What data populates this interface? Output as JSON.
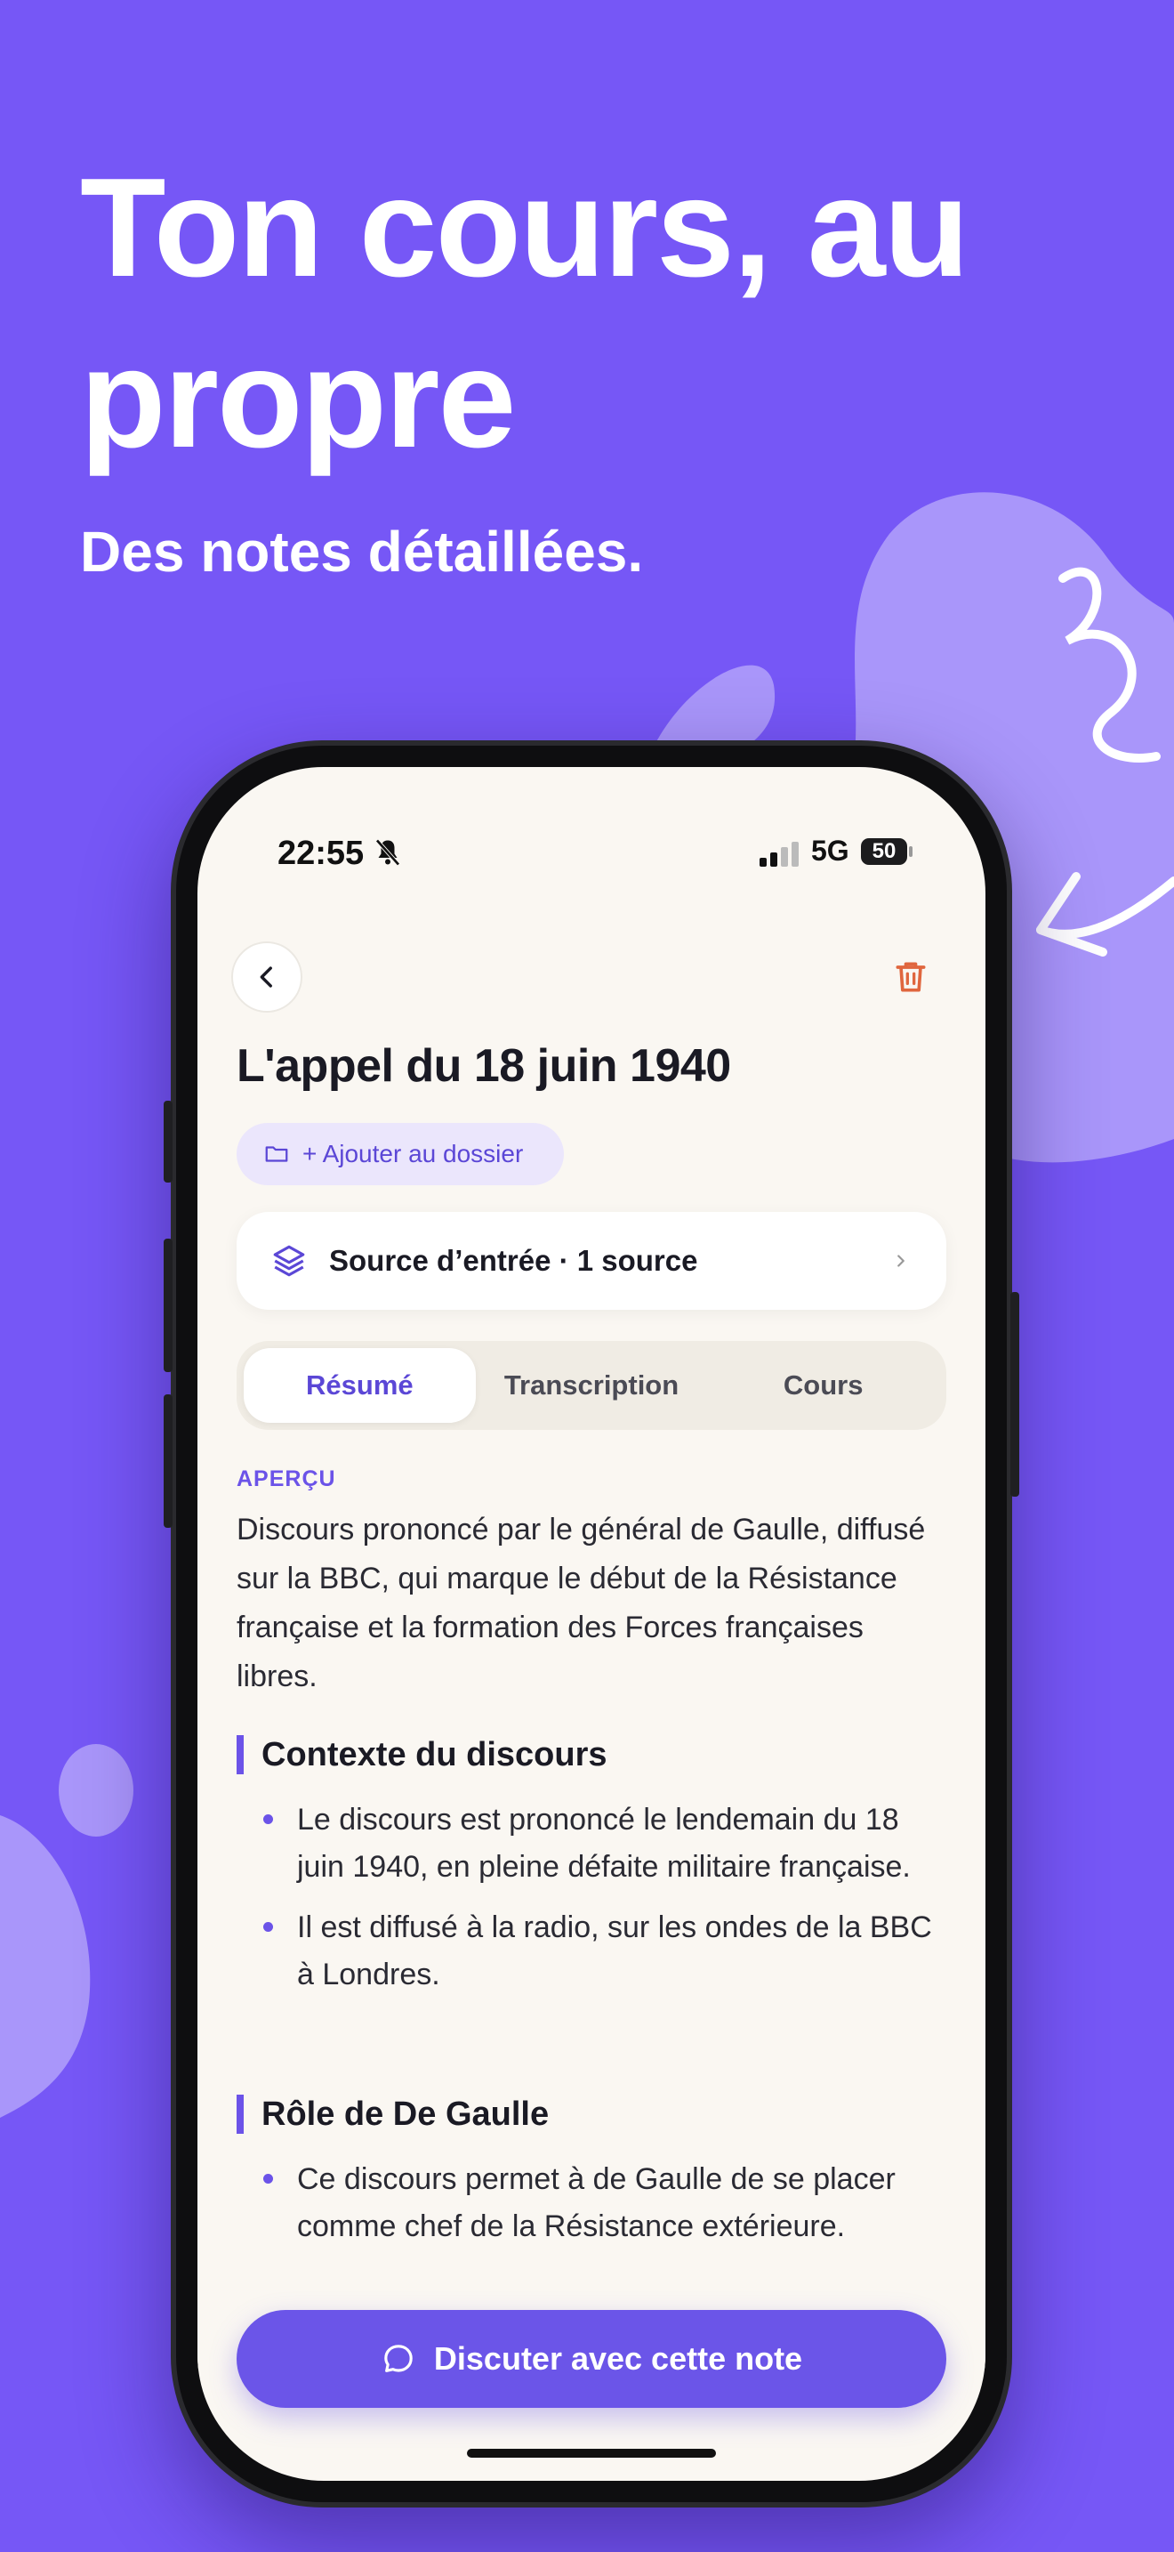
{
  "hero": {
    "title": "Ton cours, au propre",
    "subtitle": "Des notes détaillées."
  },
  "colors": {
    "background": "#7657F6",
    "accent": "#6B53E8",
    "danger": "#E0663E",
    "screen_bg": "#FAF7F2"
  },
  "status_bar": {
    "time": "22:55",
    "network": "5G",
    "battery": "50",
    "icons": [
      "bell-muted-icon",
      "signal-icon",
      "battery-icon"
    ]
  },
  "note": {
    "title": "L'appel du 18 juin 1940",
    "folder_chip": "+ Ajouter au dossier",
    "source_card": "Source d’entrée · 1 source",
    "tabs": [
      {
        "label": "Résumé",
        "active": true
      },
      {
        "label": "Transcription",
        "active": false
      },
      {
        "label": "Cours",
        "active": false
      }
    ],
    "overview_label": "APERÇU",
    "overview_text": "Discours prononcé par le général de Gaulle, diffusé sur la BBC, qui marque le début de la Résistance française et la formation des Forces françaises libres.",
    "sections": [
      {
        "heading": "Contexte du discours",
        "bullets": [
          "Le discours est prononcé le lendemain du 18 juin 1940, en pleine défaite militaire française.",
          "Il est diffusé à la radio, sur les ondes de la BBC à Londres."
        ]
      },
      {
        "heading": "Rôle de De Gaulle",
        "bullets": [
          "Ce discours permet à de Gaulle de se placer comme chef de la Résistance extérieure."
        ]
      }
    ],
    "chat_button": "Discuter avec cette note"
  }
}
